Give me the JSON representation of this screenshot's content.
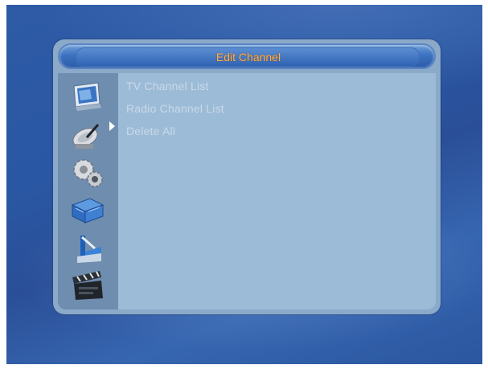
{
  "title": "Edit Channel",
  "menu": {
    "items": [
      {
        "label": "TV Channel List"
      },
      {
        "label": "Radio Channel List"
      },
      {
        "label": "Delete All"
      }
    ]
  },
  "sidebar": {
    "icons": [
      {
        "name": "tv-monitor-icon"
      },
      {
        "name": "satellite-dish-icon"
      },
      {
        "name": "gears-icon"
      },
      {
        "name": "blue-box-icon"
      },
      {
        "name": "tools-icon"
      },
      {
        "name": "clapperboard-icon"
      }
    ],
    "selected_index": 0
  },
  "colors": {
    "title_text": "#ffb14a",
    "content_bg": "#9cbbd6",
    "item_text": "#c9d9ea"
  }
}
